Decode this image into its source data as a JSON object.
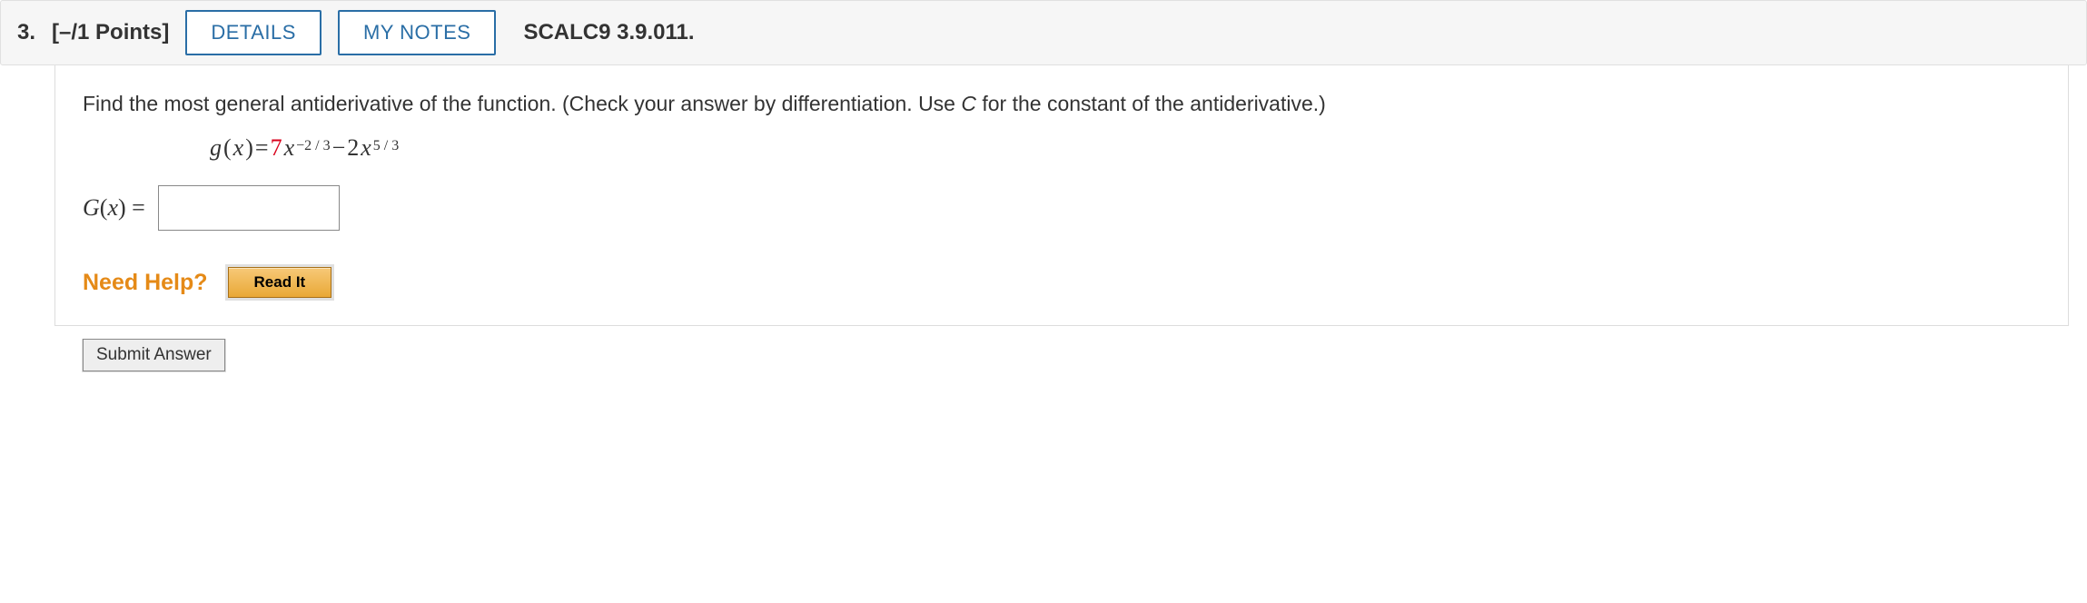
{
  "header": {
    "number": "3.",
    "points": "[–/1 Points]",
    "details_label": "DETAILS",
    "mynotes_label": "MY NOTES",
    "source": "SCALC9 3.9.011."
  },
  "prompt": {
    "text_a": "Find the most general antiderivative of the function. (Check your answer by differentiation. Use ",
    "const_letter": "C",
    "text_b": " for the constant of the antiderivative.)"
  },
  "formula": {
    "lhs_fn": "g",
    "lhs_paren_open": "(",
    "lhs_var": "x",
    "lhs_paren_close": ")",
    "eq": " = ",
    "coef1": "7",
    "var1": "x",
    "exp1": "−2 / 3",
    "minus": " − ",
    "coef2": "2",
    "var2": "x",
    "exp2": "5 / 3"
  },
  "answer": {
    "lhs_fn": "G",
    "lhs_paren_open": "(",
    "lhs_var": "x",
    "lhs_paren_close": ")",
    "eq": " = ",
    "value": ""
  },
  "help": {
    "label": "Need Help?",
    "readit": "Read It"
  },
  "submit": {
    "label": "Submit Answer"
  }
}
